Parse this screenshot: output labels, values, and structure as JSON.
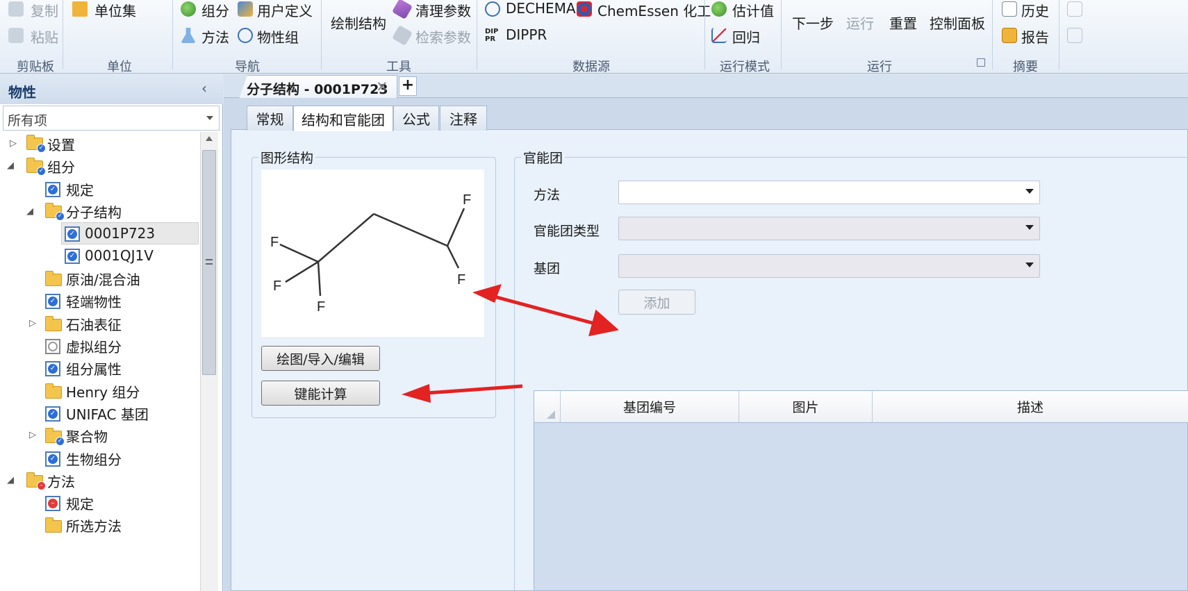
{
  "ribbon": {
    "clipboard": {
      "copy": "复制",
      "paste": "粘贴",
      "label": "剪贴板"
    },
    "units": {
      "unit_set": "单位集",
      "label": "单位"
    },
    "navigate": {
      "components": "组分",
      "user_defined": "用户定义",
      "methods": "方法",
      "prop_sets": "物性组",
      "label": "导航"
    },
    "tools": {
      "draw_structure": "绘制结构",
      "clean_params": "清理参数",
      "retrieve_params": "检索参数",
      "label": "工具"
    },
    "data_source": {
      "dechema": "DECHEMA",
      "chemessen": "ChemEssen 化工",
      "dippr": "DIPPR",
      "label": "数据源"
    },
    "run_mode": {
      "estimate": "估计值",
      "regression": "回归",
      "label": "运行模式"
    },
    "run": {
      "next": "下一步",
      "run": "运行",
      "reset": "重置",
      "control_panel": "控制面板",
      "label": "运行"
    },
    "summary": {
      "history": "历史",
      "report": "报告",
      "label": "摘要"
    }
  },
  "left_panel": {
    "title": "物性",
    "filter": "所有项",
    "tree": [
      {
        "label": "设置"
      },
      {
        "label": "组分"
      },
      {
        "label": "规定"
      },
      {
        "label": "分子结构"
      },
      {
        "label": "0001P723"
      },
      {
        "label": "0001QJ1V"
      },
      {
        "label": "原油/混合油"
      },
      {
        "label": "轻端物性"
      },
      {
        "label": "石油表征"
      },
      {
        "label": "虚拟组分"
      },
      {
        "label": "组分属性"
      },
      {
        "label": "Henry 组分"
      },
      {
        "label": "UNIFAC 基团"
      },
      {
        "label": "聚合物"
      },
      {
        "label": "生物组分"
      },
      {
        "label": "方法"
      },
      {
        "label": "规定"
      },
      {
        "label": "所选方法"
      }
    ]
  },
  "doc_tab": {
    "title": "分子结构 - 0001P723",
    "close": "×",
    "add": "+"
  },
  "page_tabs": [
    "常规",
    "结构和官能团",
    "公式",
    "注释"
  ],
  "graphic_structure": {
    "title": "图形结构",
    "atoms": [
      "F",
      "F",
      "F",
      "F",
      "F"
    ],
    "draw_button": "绘图/导入/编辑",
    "bond_energy_button": "键能计算"
  },
  "functional_group": {
    "title": "官能团",
    "method_label": "方法",
    "method_value": "",
    "type_label": "官能团类型",
    "type_value": "",
    "group_label": "基团",
    "group_value": "",
    "add_button": "添加",
    "columns": [
      "基团编号",
      "图片",
      "描述"
    ]
  },
  "colors": {
    "arrow": "#e32222",
    "accent": "#2e6fd6"
  }
}
